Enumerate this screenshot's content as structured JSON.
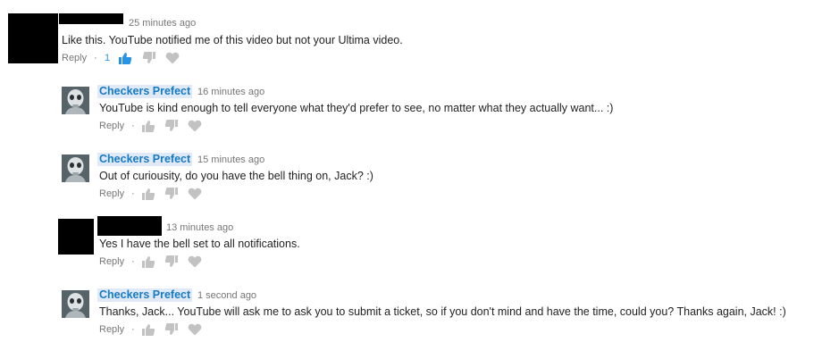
{
  "colors": {
    "link": "#167ac6",
    "name_highlight": "#dfe9f7",
    "meta": "#767676",
    "icon_inactive": "#c2c2c2",
    "icon_active": "#2793e6",
    "text": "#222222"
  },
  "comments": [
    {
      "author": "",
      "time": "25 minutes ago",
      "text": "Like this. YouTube notified me of this video but not your Ultima video.",
      "reply_label": "Reply",
      "separator": "·",
      "like_count": "1",
      "liked": true,
      "author_hidden": true
    },
    {
      "author": "Checkers Prefect",
      "time": "16 minutes ago",
      "text": "YouTube is kind enough to tell everyone what they'd prefer to see, no matter what they actually want... :)",
      "reply_label": "Reply",
      "separator": "·",
      "like_count": "",
      "liked": false
    },
    {
      "author": "Checkers Prefect",
      "time": "15 minutes ago",
      "text": "Out of curiousity, do you have the bell thing on, Jack? :)",
      "reply_label": "Reply",
      "separator": "·",
      "like_count": "",
      "liked": false
    },
    {
      "author": "",
      "time": "13 minutes ago",
      "text": "Yes I have the bell set to all notifications.",
      "reply_label": "Reply",
      "separator": "·",
      "like_count": "",
      "liked": false,
      "author_hidden": true
    },
    {
      "author": "Checkers Prefect",
      "time": "1 second ago",
      "text": "Thanks, Jack... YouTube will ask me to ask you to submit a ticket, so if you don't mind and have the time, could you? Thanks again, Jack! :)",
      "reply_label": "Reply",
      "separator": "·",
      "like_count": "",
      "liked": false
    }
  ]
}
